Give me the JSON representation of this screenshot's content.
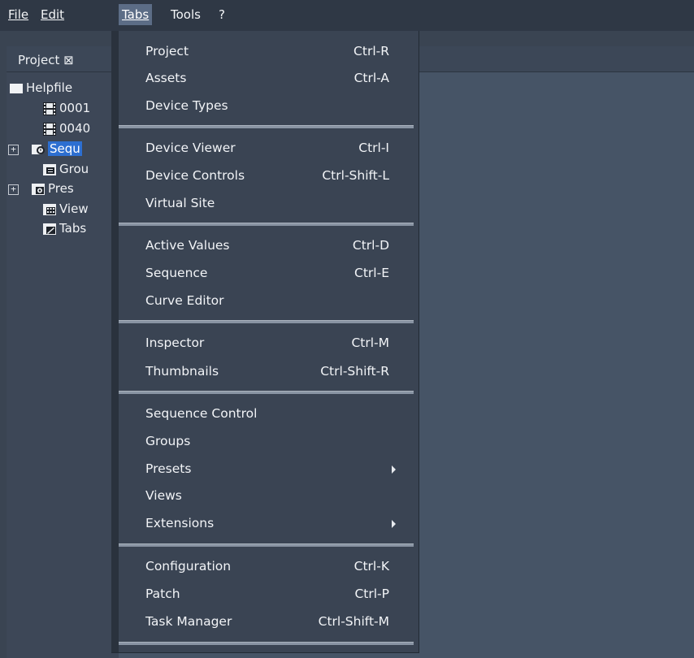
{
  "menubar": {
    "items": [
      {
        "label": "File"
      },
      {
        "label": "Edit"
      },
      {
        "label": "Tabs"
      },
      {
        "label": "Tools"
      },
      {
        "label": "?"
      }
    ]
  },
  "project_panel": {
    "tab_label": "Project ⊠",
    "tree": [
      {
        "label": "Helpfile",
        "icon": "folder-icon"
      },
      {
        "label": "0001",
        "icon": "film-icon"
      },
      {
        "label": "0040",
        "icon": "film-icon"
      },
      {
        "label": "Sequ",
        "icon": "sequence-folder-icon",
        "selected": true
      },
      {
        "label": "Grou",
        "icon": "groups-folder-icon"
      },
      {
        "label": "Pres",
        "icon": "presets-folder-icon"
      },
      {
        "label": "View",
        "icon": "views-folder-icon"
      },
      {
        "label": "Tabs",
        "icon": "tabs-folder-icon"
      }
    ]
  },
  "tabs_menu": {
    "items": [
      {
        "label": "Project",
        "shortcut": "Ctrl-R"
      },
      {
        "label": "Assets",
        "shortcut": "Ctrl-A"
      },
      {
        "label": "Device Types",
        "shortcut": ""
      },
      {
        "label": "Device Viewer",
        "shortcut": "Ctrl-I"
      },
      {
        "label": "Device Controls",
        "shortcut": "Ctrl-Shift-L"
      },
      {
        "label": "Virtual Site",
        "shortcut": ""
      },
      {
        "label": "Active Values",
        "shortcut": "Ctrl-D"
      },
      {
        "label": "Sequence",
        "shortcut": "Ctrl-E"
      },
      {
        "label": "Curve Editor",
        "shortcut": ""
      },
      {
        "label": "Inspector",
        "shortcut": "Ctrl-M"
      },
      {
        "label": "Thumbnails",
        "shortcut": "Ctrl-Shift-R"
      },
      {
        "label": "Sequence Control",
        "shortcut": ""
      },
      {
        "label": "Groups",
        "shortcut": ""
      },
      {
        "label": "Presets",
        "shortcut": "",
        "submenu": true
      },
      {
        "label": "Views",
        "shortcut": ""
      },
      {
        "label": "Extensions",
        "shortcut": "",
        "submenu": true
      },
      {
        "label": "Configuration",
        "shortcut": "Ctrl-K"
      },
      {
        "label": "Patch",
        "shortcut": "Ctrl-P"
      },
      {
        "label": "Task Manager",
        "shortcut": "Ctrl-Shift-M"
      }
    ]
  },
  "colors": {
    "background": "#3a4452",
    "menu_background": "#3a4453",
    "active_menu": "#5c6d86",
    "selection": "#2d6fd1",
    "workspace": "#465466"
  }
}
